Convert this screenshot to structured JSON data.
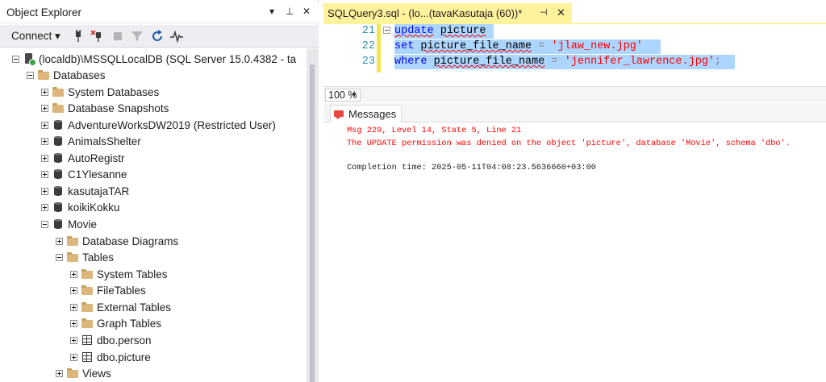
{
  "object_explorer": {
    "title": "Object Explorer",
    "title_controls": [
      "▾",
      "⊥",
      "✕"
    ],
    "toolbar": {
      "connect_label": "Connect ▾",
      "icons": [
        "connect-plug-icon",
        "disconnect-plug-icon",
        "stop-icon",
        "filter-icon",
        "refresh-icon",
        "activity-monitor-icon"
      ]
    },
    "tree": [
      {
        "label": "(localdb)\\MSSQLLocalDB (SQL Server 15.0.4382 - ta",
        "icon": "server-icon",
        "expanded": true
      },
      {
        "label": "Databases",
        "icon": "folder-icon",
        "expanded": true
      },
      {
        "label": "System Databases",
        "icon": "folder-icon",
        "expanded": false
      },
      {
        "label": "Database Snapshots",
        "icon": "folder-icon",
        "expanded": false
      },
      {
        "label": "AdventureWorksDW2019 (Restricted User)",
        "icon": "database-icon",
        "expanded": false
      },
      {
        "label": "AnimalsShelter",
        "icon": "database-icon",
        "expanded": false
      },
      {
        "label": "AutoRegistr",
        "icon": "database-icon",
        "expanded": false
      },
      {
        "label": "C1Ylesanne",
        "icon": "database-icon",
        "expanded": false
      },
      {
        "label": "kasutajaTAR",
        "icon": "database-icon",
        "expanded": false
      },
      {
        "label": "koikiKokku",
        "icon": "database-icon",
        "expanded": false
      },
      {
        "label": "Movie",
        "icon": "database-icon",
        "expanded": true
      },
      {
        "label": "Database Diagrams",
        "icon": "folder-icon",
        "expanded": false
      },
      {
        "label": "Tables",
        "icon": "folder-icon",
        "expanded": true
      },
      {
        "label": "System Tables",
        "icon": "folder-icon",
        "expanded": false
      },
      {
        "label": "FileTables",
        "icon": "folder-icon",
        "expanded": false
      },
      {
        "label": "External Tables",
        "icon": "folder-icon",
        "expanded": false
      },
      {
        "label": "Graph Tables",
        "icon": "folder-icon",
        "expanded": false
      },
      {
        "label": "dbo.person",
        "icon": "table-icon",
        "expanded": false
      },
      {
        "label": "dbo.picture",
        "icon": "table-icon",
        "expanded": false
      },
      {
        "label": "Views",
        "icon": "folder-icon",
        "expanded": false
      }
    ]
  },
  "editor": {
    "tab": {
      "title": "SQLQuery3.sql - (lo...(tavaKasutaja (60))*",
      "pin": "⊣",
      "close": "✕"
    },
    "lines": [
      {
        "number": "21",
        "tokens": [
          [
            "kw squig",
            "update"
          ],
          [
            "id",
            " "
          ],
          [
            "id squig",
            "picture"
          ]
        ]
      },
      {
        "number": "22",
        "tokens": [
          [
            "kw",
            "set"
          ],
          [
            "id",
            " "
          ],
          [
            "id squig",
            "picture_file_name"
          ],
          [
            "id",
            " "
          ],
          [
            "op",
            "="
          ],
          [
            "id",
            " "
          ],
          [
            "str",
            "'jlaw_new.jpg'"
          ]
        ]
      },
      {
        "number": "23",
        "tokens": [
          [
            "kw",
            "where"
          ],
          [
            "id",
            " "
          ],
          [
            "id squig",
            "picture_file_name"
          ],
          [
            "id",
            " "
          ],
          [
            "op",
            "="
          ],
          [
            "id",
            " "
          ],
          [
            "str",
            "'jennifer_lawrence.jpg'"
          ],
          [
            "op",
            ";"
          ]
        ]
      }
    ],
    "zoom": "100 %"
  },
  "results": {
    "tab_label": "Messages",
    "messages": [
      {
        "text": "Msg 229, Level 14, State 5, Line 21",
        "kind": "error"
      },
      {
        "text": "The UPDATE permission was denied on the object 'picture', database 'Movie', schema 'dbo'.",
        "kind": "error"
      },
      {
        "text": "",
        "kind": "ok"
      },
      {
        "text": "Completion time: 2025-05-11T04:08:23.5636660+03:00",
        "kind": "ok"
      }
    ]
  },
  "colors": {
    "tab_active": "#fff29d",
    "selection": "#add6ff",
    "keyword": "#0000ff",
    "string": "#ff0000",
    "error_text": "#ff0000",
    "line_number": "#2b91af"
  }
}
